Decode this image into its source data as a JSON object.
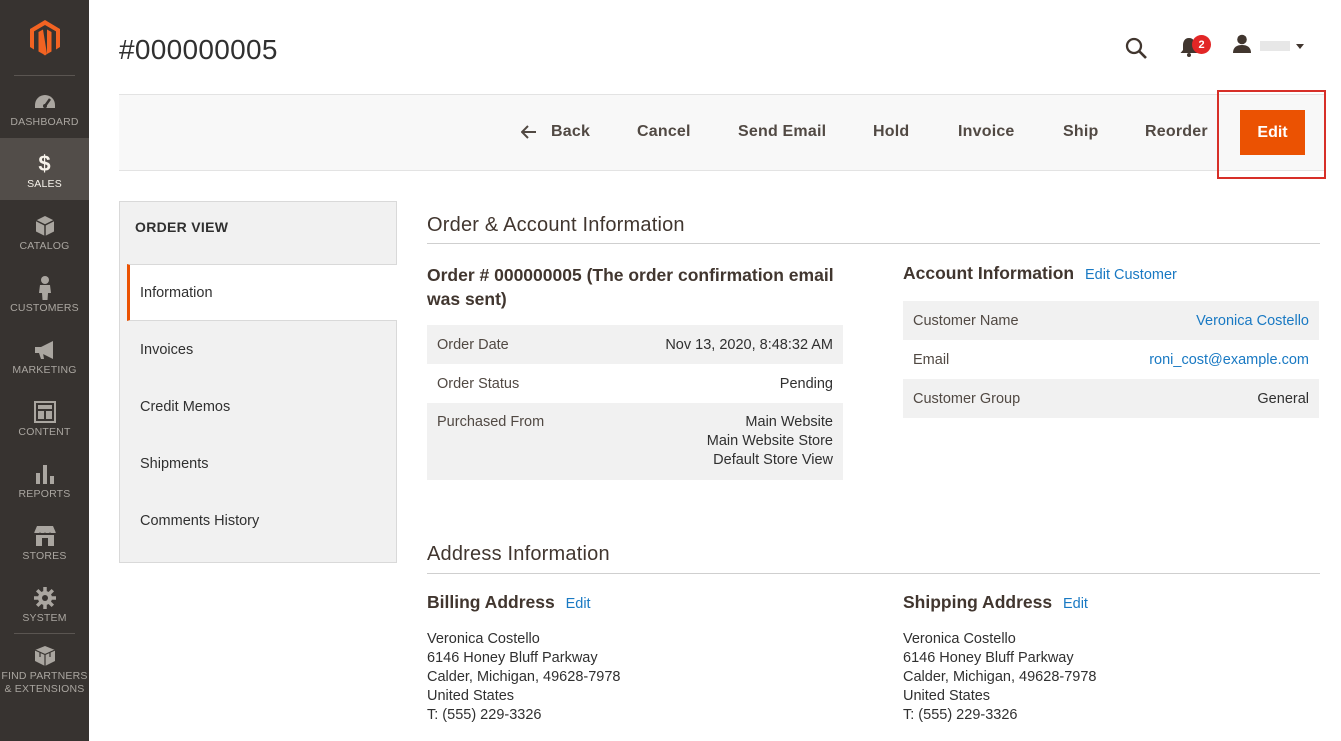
{
  "nav": {
    "logo_icon": "magento-logo-icon",
    "items": [
      {
        "label": "DASHBOARD",
        "icon": "dashboard-icon"
      },
      {
        "label": "SALES",
        "icon": "dollar-icon"
      },
      {
        "label": "CATALOG",
        "icon": "box-icon"
      },
      {
        "label": "CUSTOMERS",
        "icon": "person-icon"
      },
      {
        "label": "MARKETING",
        "icon": "megaphone-icon"
      },
      {
        "label": "CONTENT",
        "icon": "layout-icon"
      },
      {
        "label": "REPORTS",
        "icon": "bar-chart-icon"
      },
      {
        "label": "STORES",
        "icon": "store-icon"
      },
      {
        "label": "SYSTEM",
        "icon": "gear-icon"
      },
      {
        "label": "FIND PARTNERS\n& EXTENSIONS",
        "icon": "extensions-icon"
      }
    ],
    "active": "SALES"
  },
  "header": {
    "title": "#000000005",
    "notification_count": "2"
  },
  "actions": {
    "back": "Back",
    "cancel": "Cancel",
    "send_email": "Send Email",
    "hold": "Hold",
    "invoice": "Invoice",
    "ship": "Ship",
    "reorder": "Reorder",
    "edit": "Edit"
  },
  "tabs": {
    "title": "ORDER VIEW",
    "items": [
      "Information",
      "Invoices",
      "Credit Memos",
      "Shipments",
      "Comments History"
    ],
    "active": "Information"
  },
  "order_account": {
    "section_title": "Order & Account Information",
    "order_title": "Order # 000000005 (The order confirmation email was sent)",
    "order_rows": [
      {
        "label": "Order Date",
        "value": "Nov 13, 2020, 8:48:32 AM"
      },
      {
        "label": "Order Status",
        "value": "Pending"
      },
      {
        "label": "Purchased From",
        "value": [
          "Main Website",
          "Main Website Store",
          "Default Store View"
        ]
      }
    ],
    "account_title": "Account Information",
    "edit_customer": "Edit Customer",
    "account_rows": [
      {
        "label": "Customer Name",
        "value": "Veronica Costello",
        "link": true
      },
      {
        "label": "Email",
        "value": "roni_cost@example.com",
        "link": true
      },
      {
        "label": "Customer Group",
        "value": "General",
        "link": false
      }
    ]
  },
  "address": {
    "section_title": "Address Information",
    "billing": {
      "title": "Billing Address",
      "edit": "Edit",
      "lines": [
        "Veronica Costello",
        "6146 Honey Bluff Parkway",
        "Calder, Michigan, 49628-7978",
        "United States",
        "T: (555) 229-3326"
      ]
    },
    "shipping": {
      "title": "Shipping Address",
      "edit": "Edit",
      "lines": [
        "Veronica Costello",
        "6146 Honey Bluff Parkway",
        "Calder, Michigan, 49628-7978",
        "United States",
        "T: (555) 229-3326"
      ]
    }
  },
  "colors": {
    "nav_bg": "#373330",
    "accent": "#eb5202",
    "link": "#1979c3",
    "highlight_border": "#d72f28"
  }
}
